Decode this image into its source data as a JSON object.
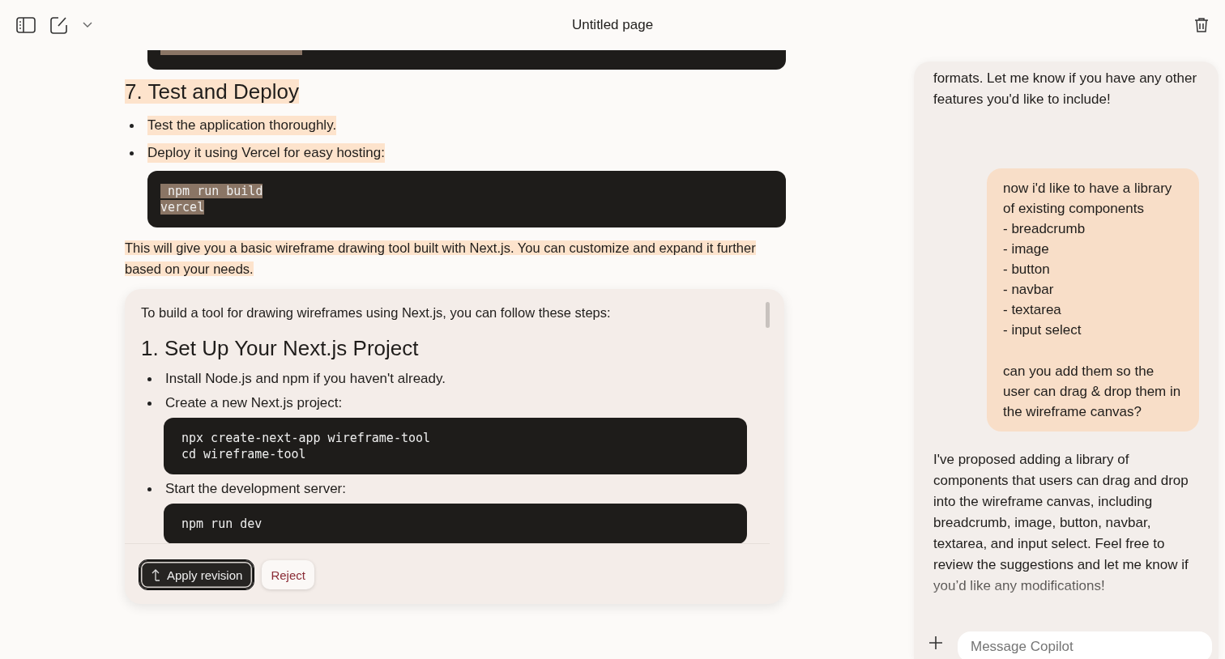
{
  "header": {
    "title": "Untitled page"
  },
  "document": {
    "blocks": [
      {
        "kind": "code_tail",
        "highlighted": true
      },
      {
        "kind": "heading",
        "text": "7. Test and Deploy",
        "highlighted": true
      },
      {
        "kind": "bullet",
        "text": "Test the application thoroughly.",
        "highlighted": true
      },
      {
        "kind": "bullet",
        "text": "Deploy it using Vercel for easy hosting:",
        "highlighted": true
      },
      {
        "kind": "code",
        "lines": [
          " npm run build",
          "vercel"
        ],
        "highlighted": true
      },
      {
        "kind": "paragraph",
        "text": "This will give you a basic wireframe drawing tool built with Next.js. You can customize and expand it further based on your needs.",
        "highlighted": true
      }
    ]
  },
  "revision": {
    "blocks": [
      {
        "kind": "paragraph",
        "text": "To build a tool for drawing wireframes using Next.js, you can follow these steps:",
        "highlighted": false
      },
      {
        "kind": "heading",
        "text": "1. Set Up Your Next.js Project",
        "highlighted": false
      },
      {
        "kind": "bullet",
        "text": "Install Node.js and npm if you haven't already.",
        "highlighted": false
      },
      {
        "kind": "bullet",
        "text": "Create a new Next.js project:",
        "highlighted": false
      },
      {
        "kind": "code",
        "lines": [
          "npx create-next-app wireframe-tool",
          "cd wireframe-tool"
        ],
        "highlighted": false
      },
      {
        "kind": "bullet",
        "text": "Start the development server:",
        "highlighted": false
      },
      {
        "kind": "code",
        "lines": [
          "npm run dev"
        ],
        "highlighted": false
      }
    ],
    "buttons": [
      {
        "label": "Apply revision",
        "kind": "primary"
      },
      {
        "label": "Reject",
        "kind": "secondary"
      }
    ]
  },
  "chat": {
    "messages": [
      {
        "kind": "assistant",
        "paragraphs": [
          "formats. Let me know if you have any other features you'd like to include!"
        ]
      },
      {
        "kind": "user",
        "paragraphs": [
          "now i'd like to have a library of existing components",
          "- breadcrumb",
          "- image",
          "- button",
          "- navbar",
          "- textarea",
          "- input select",
          "can you add them so the user can drag & drop them in the wireframe canvas?"
        ]
      },
      {
        "kind": "assistant",
        "paragraphs": [
          "I've proposed adding a library of components that users can drag and drop into the wireframe canvas, including breadcrumb, image, button, navbar, textarea, and input select. Feel free to review the suggestions and let me know if you’d like any modifications!"
        ]
      }
    ],
    "input": {
      "placeholder": "Message Copilot"
    }
  }
}
